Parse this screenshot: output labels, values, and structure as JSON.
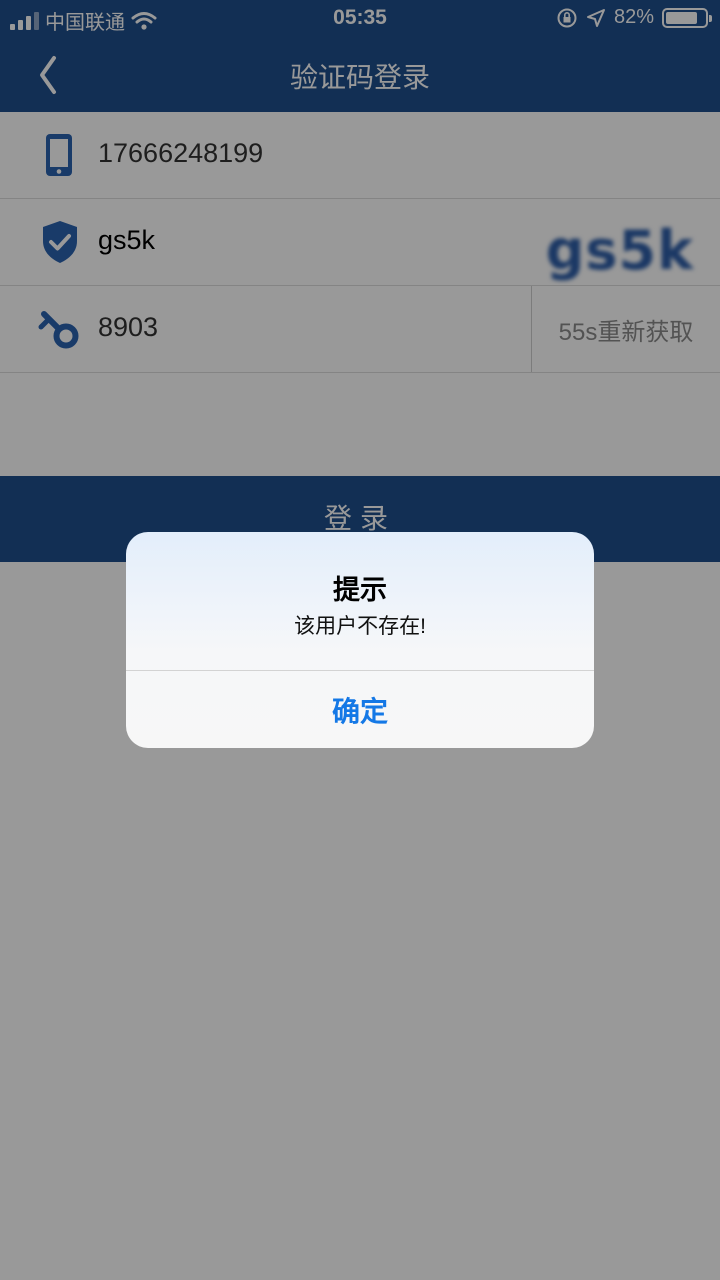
{
  "status_bar": {
    "carrier": "中国联通",
    "time": "05:35",
    "battery_percent": "82%",
    "battery_level": 0.82,
    "icons": [
      "signal-icon",
      "wifi-icon",
      "orientation-lock-icon",
      "location-icon",
      "battery-icon"
    ]
  },
  "nav": {
    "title": "验证码登录",
    "back_icon": "chevron-left-icon"
  },
  "form": {
    "phone": {
      "value": "17666248199",
      "icon": "phone-icon"
    },
    "image_code": {
      "value": "gs5k",
      "captcha_text": "gs5k",
      "icon": "shield-check-icon"
    },
    "sms_code": {
      "value": "8903",
      "resend_label": "55s重新获取",
      "icon": "key-icon"
    }
  },
  "login_button": {
    "label": "登录"
  },
  "dialog": {
    "title": "提示",
    "message": "该用户不存在!",
    "confirm_label": "确定"
  },
  "colors": {
    "brand": "#1f4f8c",
    "dialog_button": "#1478e6",
    "overlay": "#9a9a9a"
  }
}
